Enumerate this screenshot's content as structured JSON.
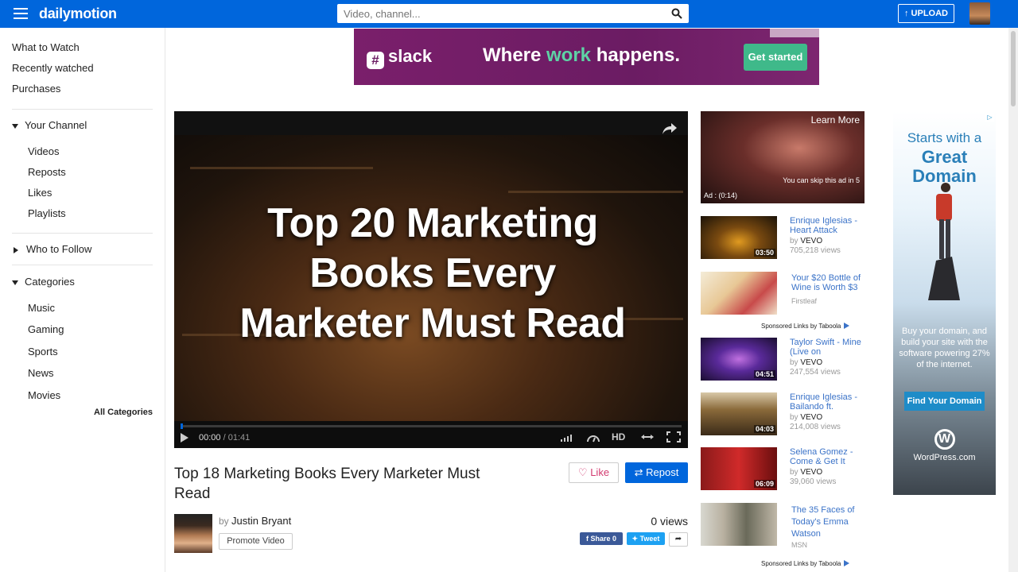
{
  "header": {
    "logo": "dailymotion",
    "search_placeholder": "Video, channel...",
    "upload_label": "UPLOAD"
  },
  "sidebar": {
    "top_links": [
      "What to Watch",
      "Recently watched",
      "Purchases"
    ],
    "your_channel": {
      "label": "Your Channel",
      "items": [
        "Videos",
        "Reposts",
        "Likes",
        "Playlists"
      ]
    },
    "who_to_follow": "Who to Follow",
    "categories": {
      "label": "Categories",
      "items": [
        "Music",
        "Gaming",
        "Sports",
        "News",
        "Movies"
      ],
      "all_label": "All Categories"
    }
  },
  "banner_ad": {
    "brand": "slack",
    "tagline_1": "Where ",
    "tagline_2": "work",
    "tagline_3": " happens.",
    "cta": "Get started"
  },
  "player": {
    "overlay_title": "Top 20 Marketing Books Every Marketer Must Read",
    "current_time": "00:00",
    "duration": "01:41",
    "quality": "HD",
    "progress": 0
  },
  "video": {
    "title": "Top 18 Marketing Books Every Marketer Must Read",
    "like_label": "Like",
    "repost_label": "Repost",
    "by_prefix": "by",
    "owner": "Justin Bryant",
    "promote_label": "Promote Video",
    "views": "0 views",
    "share_fb": "Share 0",
    "share_tw": "Tweet"
  },
  "ad_video": {
    "learn_more": "Learn More",
    "skip_text": "You can skip this ad in 5",
    "ad_timer": "Ad : (0:14)"
  },
  "related": [
    {
      "title": "Enrique Iglesias - Heart Attack",
      "by": "VEVO",
      "views": "705,218 views",
      "duration": "03:50"
    },
    {
      "title": "Your $20 Bottle of Wine is Worth $3",
      "source": "Firstleaf"
    },
    {
      "title": "Taylor Swift - Mine (Live on",
      "by": "VEVO",
      "views": "247,554 views",
      "duration": "04:51"
    },
    {
      "title": "Enrique Iglesias - Bailando ft.",
      "by": "VEVO",
      "views": "214,008 views",
      "duration": "04:03"
    },
    {
      "title": "Selena Gomez - Come & Get It",
      "by": "VEVO",
      "views": "39,060 views",
      "duration": "06:09"
    },
    {
      "title": "The 35 Faces of Today's Emma Watson",
      "source": "MSN"
    }
  ],
  "sponsored_label": "Sponsored Links by Taboola",
  "by_label": "by",
  "side_ad": {
    "line1": "Starts with a",
    "line2": "Great Domain",
    "body": "Buy your domain, and build your site with the software powering 27% of the internet.",
    "cta": "Find Your Domain",
    "brand": "WordPress.com"
  }
}
